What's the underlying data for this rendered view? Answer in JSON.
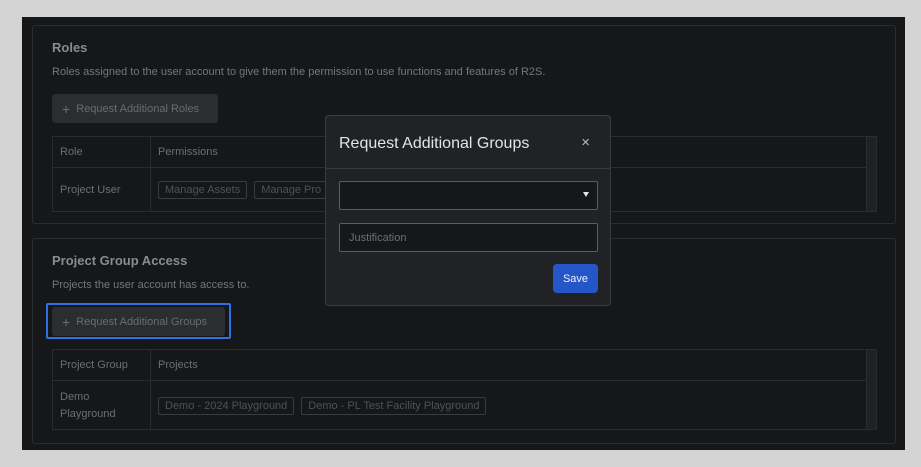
{
  "roles": {
    "title": "Roles",
    "description": "Roles assigned to the user account to give them the permission to use functions and features of R2S.",
    "add_button": "Request Additional Roles",
    "columns": [
      "Role",
      "Permissions"
    ],
    "rows": [
      {
        "role": "Project User",
        "permissions": [
          "Manage Assets",
          "Manage Pro"
        ]
      }
    ]
  },
  "groups": {
    "title": "Project Group Access",
    "description": "Projects the user account has access to.",
    "add_button": "Request Additional Groups",
    "columns": [
      "Project Group",
      "Projects"
    ],
    "rows": [
      {
        "group": "Demo Playground",
        "projects": [
          "Demo - 2024 Playground",
          "Demo - PL Test Facility Playground"
        ]
      }
    ]
  },
  "modal": {
    "title": "Request Additional Groups",
    "close": "×",
    "select_value": "",
    "justification_placeholder": "Justification",
    "save_label": "Save"
  },
  "colors": {
    "accent": "#2556c8",
    "focus": "#2f6fe3",
    "background": "#161719"
  },
  "icons": {
    "add": "plus-icon",
    "close": "close-icon",
    "dropdown": "caret-down-icon"
  }
}
